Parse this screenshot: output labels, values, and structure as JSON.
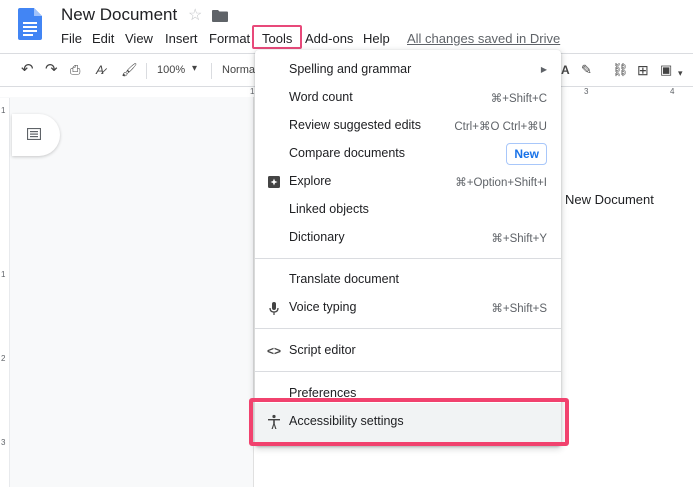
{
  "header": {
    "doc_title": "New Document",
    "saved_status": "All changes saved in Drive"
  },
  "menubar": {
    "items": [
      {
        "label": "File"
      },
      {
        "label": "Edit"
      },
      {
        "label": "View"
      },
      {
        "label": "Insert"
      },
      {
        "label": "Format"
      },
      {
        "label": "Tools"
      },
      {
        "label": "Add-ons"
      },
      {
        "label": "Help"
      }
    ]
  },
  "toolbar": {
    "zoom": "100%",
    "style": "Normal"
  },
  "ruler": {
    "top_numbers": [
      "1",
      "3",
      "4"
    ],
    "left_numbers": [
      "1",
      "1",
      "2",
      "3"
    ]
  },
  "document": {
    "body_text": "New Document"
  },
  "tools_menu": {
    "items": [
      {
        "label": "Spelling and grammar",
        "shortcut": ""
      },
      {
        "label": "Word count",
        "shortcut": "⌘+Shift+C"
      },
      {
        "label": "Review suggested edits",
        "shortcut": "Ctrl+⌘O Ctrl+⌘U"
      },
      {
        "label": "Compare documents",
        "badge": "New"
      },
      {
        "label": "Explore",
        "shortcut": "⌘+Option+Shift+I"
      },
      {
        "label": "Linked objects",
        "shortcut": ""
      },
      {
        "label": "Dictionary",
        "shortcut": "⌘+Shift+Y"
      },
      {
        "label": "Translate document",
        "shortcut": ""
      },
      {
        "label": "Voice typing",
        "shortcut": "⌘+Shift+S"
      },
      {
        "label": "Script editor",
        "shortcut": ""
      },
      {
        "label": "Preferences",
        "shortcut": ""
      },
      {
        "label": "Accessibility settings",
        "shortcut": ""
      }
    ]
  },
  "colors": {
    "highlight": "#f1426e",
    "docs_blue": "#4285f4",
    "badge_blue": "#1a73e8"
  }
}
